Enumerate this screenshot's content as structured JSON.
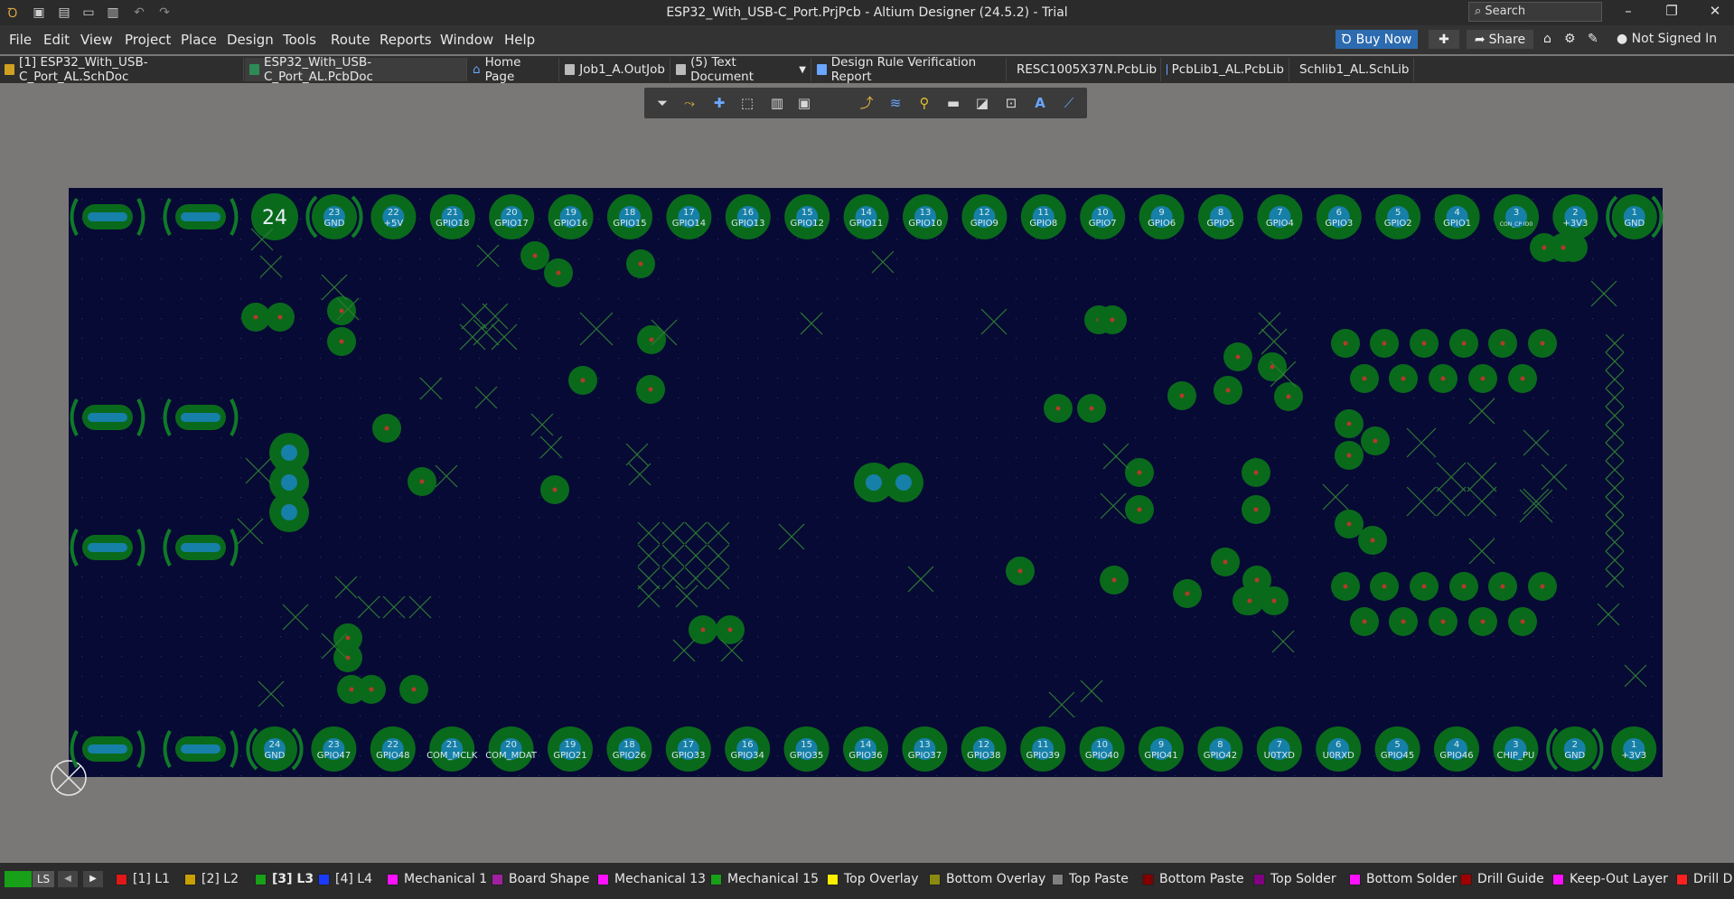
{
  "window": {
    "title": "ESP32_With_USB-C_Port.PrjPcb - Altium Designer (24.5.2) - Trial"
  },
  "search": {
    "placeholder": "Search"
  },
  "menu": [
    "File",
    "Edit",
    "View",
    "Project",
    "Place",
    "Design",
    "Tools",
    "Route",
    "Reports",
    "Window",
    "Help"
  ],
  "header_buttons": {
    "buy_now": "Buy Now",
    "share": "Share",
    "user": "Not Signed In"
  },
  "tabs": [
    {
      "label": "[1] ESP32_With_USB-C_Port_AL.SchDoc",
      "icon": "schematic-doc-icon",
      "color": "#d0a020"
    },
    {
      "label": "ESP32_With_USB-C_Port_AL.PcbDoc",
      "icon": "pcb-doc-icon",
      "color": "#2e8b57"
    },
    {
      "label": "Home Page",
      "icon": "home-icon",
      "color": "#6aa6ff"
    },
    {
      "label": "Job1_A.OutJob",
      "icon": "outjob-icon",
      "color": "#bbbbbb"
    },
    {
      "label": "(5) Text Document",
      "icon": "text-doc-icon",
      "color": "#bbbbbb"
    },
    {
      "label": "Design Rule Verification Report",
      "icon": "report-icon",
      "color": "#6aa6ff"
    },
    {
      "label": "RESC1005X37N.PcbLib",
      "icon": "pcblib-icon",
      "color": "#6aa6ff"
    },
    {
      "label": "PcbLib1_AL.PcbLib",
      "icon": "pcblib-icon",
      "color": "#6aa6ff"
    },
    {
      "label": "Schlib1_AL.SchLib",
      "icon": "schlib-icon",
      "color": "#d0a020"
    }
  ],
  "pcb": {
    "top_big_label": "24",
    "top_pins": [
      {
        "n": "23",
        "name": "GND"
      },
      {
        "n": "22",
        "name": "+5V"
      },
      {
        "n": "21",
        "name": "GPIO18"
      },
      {
        "n": "20",
        "name": "GPIO17"
      },
      {
        "n": "19",
        "name": "GPIO16"
      },
      {
        "n": "18",
        "name": "GPIO15"
      },
      {
        "n": "17",
        "name": "GPIO14"
      },
      {
        "n": "16",
        "name": "GPIO13"
      },
      {
        "n": "15",
        "name": "GPIO12"
      },
      {
        "n": "14",
        "name": "GPIO11"
      },
      {
        "n": "13",
        "name": "GPIO10"
      },
      {
        "n": "12",
        "name": "GPIO9"
      },
      {
        "n": "11",
        "name": "GPIO8"
      },
      {
        "n": "10",
        "name": "GPIO7"
      },
      {
        "n": "9",
        "name": "GPIO6"
      },
      {
        "n": "8",
        "name": "GPIO5"
      },
      {
        "n": "7",
        "name": "GPIO4"
      },
      {
        "n": "6",
        "name": "GPIO3"
      },
      {
        "n": "5",
        "name": "GPIO2"
      },
      {
        "n": "4",
        "name": "GPIO1"
      },
      {
        "n": "3",
        "name": "CON_CP IO0"
      },
      {
        "n": "2",
        "name": "+3V3"
      },
      {
        "n": "1",
        "name": "GND"
      }
    ],
    "bottom_pins": [
      {
        "n": "24",
        "name": "GND"
      },
      {
        "n": "23",
        "name": "GPIO47"
      },
      {
        "n": "22",
        "name": "GPIO48"
      },
      {
        "n": "21",
        "name": "COM_MCLK"
      },
      {
        "n": "20",
        "name": "COM_MDAT"
      },
      {
        "n": "19",
        "name": "GPIO21"
      },
      {
        "n": "18",
        "name": "GPIO26"
      },
      {
        "n": "17",
        "name": "GPIO33"
      },
      {
        "n": "16",
        "name": "GPIO34"
      },
      {
        "n": "15",
        "name": "GPIO35"
      },
      {
        "n": "14",
        "name": "GPIO36"
      },
      {
        "n": "13",
        "name": "GPIO37"
      },
      {
        "n": "12",
        "name": "GPIO38"
      },
      {
        "n": "11",
        "name": "GPIO39"
      },
      {
        "n": "10",
        "name": "GPIO40"
      },
      {
        "n": "9",
        "name": "GPIO41"
      },
      {
        "n": "8",
        "name": "GPIO42"
      },
      {
        "n": "7",
        "name": "U0TXD"
      },
      {
        "n": "6",
        "name": "U0RXD"
      },
      {
        "n": "5",
        "name": "GPIO45"
      },
      {
        "n": "4",
        "name": "GPIO46"
      },
      {
        "n": "3",
        "name": "CHIP_PU"
      },
      {
        "n": "2",
        "name": "GND"
      },
      {
        "n": "1",
        "name": "+3V3"
      }
    ]
  },
  "status": {
    "ls_label": "LS",
    "layers": [
      {
        "label": "[1] L1",
        "color": "#e01818"
      },
      {
        "label": "[2] L2",
        "color": "#c8a000"
      },
      {
        "label": "[3] L3",
        "color": "#18a018",
        "active": true
      },
      {
        "label": "[4] L4",
        "color": "#1a3aff"
      },
      {
        "label": "Mechanical 1",
        "color": "#ff10ff"
      },
      {
        "label": "Board Shape",
        "color": "#a020a0"
      },
      {
        "label": "Mechanical 13",
        "color": "#ff10ff"
      },
      {
        "label": "Mechanical 15",
        "color": "#18a018"
      },
      {
        "label": "Top Overlay",
        "color": "#ffee00"
      },
      {
        "label": "Bottom Overlay",
        "color": "#8a8a10"
      },
      {
        "label": "Top Paste",
        "color": "#808080"
      },
      {
        "label": "Bottom Paste",
        "color": "#800000"
      },
      {
        "label": "Top Solder",
        "color": "#800080"
      },
      {
        "label": "Bottom Solder",
        "color": "#ff10ff"
      },
      {
        "label": "Drill Guide",
        "color": "#a00000"
      },
      {
        "label": "Keep-Out Layer",
        "color": "#ff10ff"
      },
      {
        "label": "Drill D",
        "color": "#ff2020"
      }
    ]
  }
}
